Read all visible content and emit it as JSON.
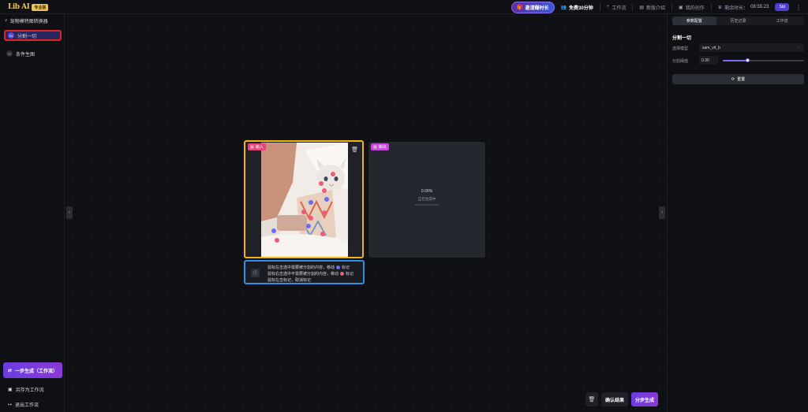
{
  "app": {
    "logo_text": "Lib AI",
    "badge": "专业版"
  },
  "topbar": {
    "invite_label": "邀请赚时长",
    "free_label": "免费30分钟",
    "workflow_label": "工作流",
    "new_intro_label": "新版介绍",
    "my_works_label": "我的创作",
    "remaining_label": "剩余时长：",
    "remaining_time": "08:55:23",
    "small_btn_label": "Std"
  },
  "sidebar": {
    "title": "宠物模特图转换器",
    "items": [
      {
        "label": "分割一切",
        "num": "01"
      },
      {
        "label": "条件生图",
        "num": "02"
      }
    ],
    "oneclick_label": "一步生成（工作流）",
    "save_workflow_label": "另存为工作流",
    "exit_workflow_label": "退出工作流"
  },
  "input_card": {
    "tag": "输入"
  },
  "output_card": {
    "tag": "输出",
    "percent": "0.00%",
    "status": "正在生成中",
    "progress": 0
  },
  "hint": {
    "line1": "鼠标左击选中需要被分割的内容，移动",
    "line1_suffix": "标记",
    "line2": "鼠标右击选中不需要被分割的内容，移动",
    "line2_suffix": "标记",
    "line3": "鼠标左击标记，取消标记"
  },
  "actions": {
    "confirm_label": "确认结果",
    "generate_label": "分步生成"
  },
  "right_panel": {
    "tabs": [
      "参数配置",
      "历史记录",
      "工作流"
    ],
    "active_tab": 0,
    "section_title": "分割一切",
    "model_label": "选择模型",
    "model_value": "sam_vit_b",
    "threshold_label": "分割阈值",
    "threshold_value": "0.30",
    "threshold_fraction": 0.3,
    "reset_label": "重置"
  },
  "colors": {
    "accent": "#6a3ce0",
    "input_border": "#f2b518",
    "hint_border": "#2f8fe8",
    "highlight": "#e02424"
  }
}
